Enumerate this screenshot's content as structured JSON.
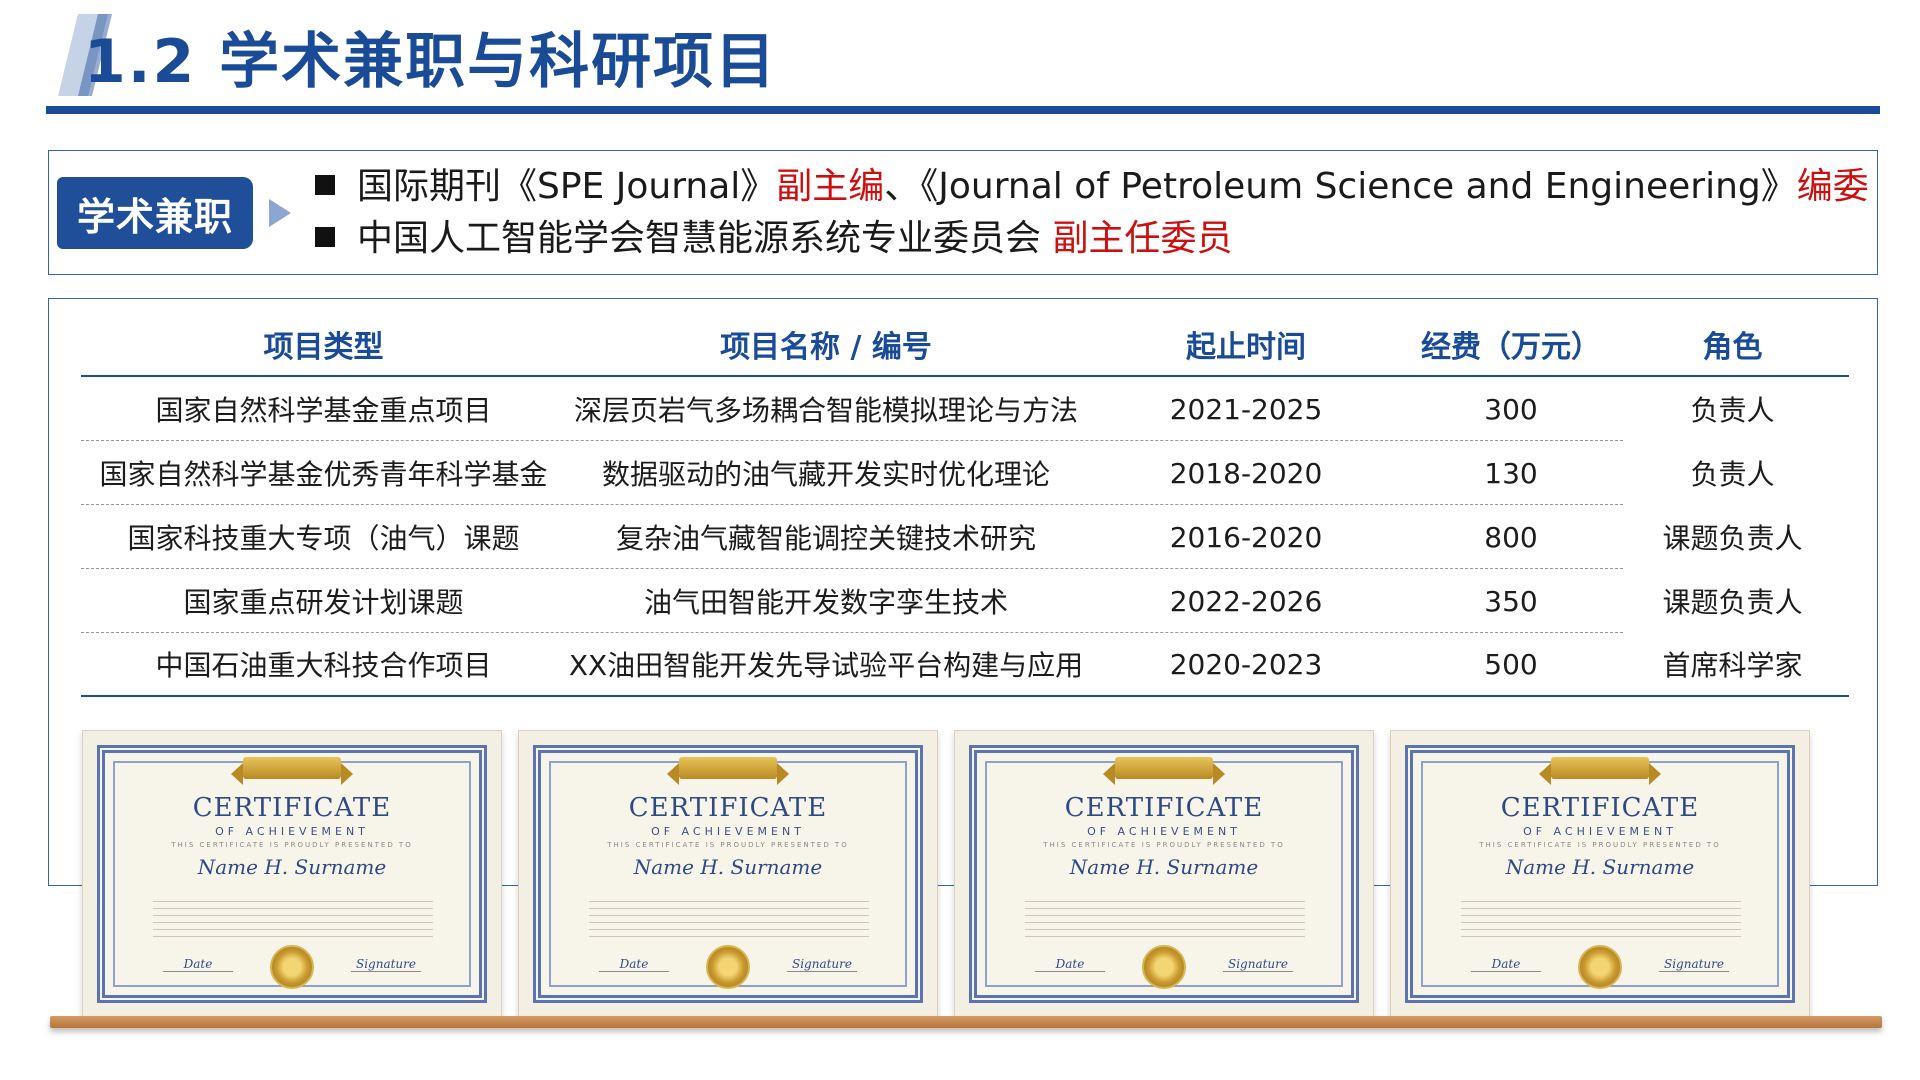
{
  "slide": {
    "title": "1.2 学术兼职与科研项目"
  },
  "academic": {
    "tag": "学术兼职",
    "items": [
      {
        "prefix": "国际期刊《SPE Journal》",
        "role1": "副主编",
        "middle": "、《Journal of Petroleum Science and Engineering》",
        "role2": "编委"
      },
      {
        "prefix": "中国人工智能学会智慧能源系统专业委员会 ",
        "role1": "副主任委员"
      }
    ]
  },
  "projects": {
    "headers": [
      "项目类型",
      "项目名称 / 编号",
      "起止时间",
      "经费（万元）",
      "角色"
    ],
    "rows": [
      [
        "国家自然科学基金重点项目",
        "深层页岩气多场耦合智能模拟理论与方法",
        "2021-2025",
        "300",
        "负责人"
      ],
      [
        "国家自然科学基金优秀青年科学基金",
        "数据驱动的油气藏开发实时优化理论",
        "2018-2020",
        "130",
        "负责人"
      ],
      [
        "国家科技重大专项（油气）课题",
        "复杂油气藏智能调控关键技术研究",
        "2016-2020",
        "800",
        "课题负责人"
      ],
      [
        "国家重点研发计划课题",
        "油气田智能开发数字孪生技术",
        "2022-2026",
        "350",
        "课题负责人"
      ],
      [
        "中国石油重大科技合作项目",
        "XX油田智能开发先导试验平台构建与应用",
        "2020-2023",
        "500",
        "首席科学家"
      ]
    ]
  },
  "certificate": {
    "heading": "CERTIFICATE",
    "sub": "OF ACHIEVEMENT",
    "tagline": "THIS CERTIFICATE IS PROUDLY PRESENTED TO",
    "name": "Name H. Surname",
    "date_label": "Date",
    "sign_label": "Signature"
  },
  "colors": {
    "brand": "#1a4b96",
    "accent_red": "#cc1010",
    "border": "#2f66b3"
  }
}
